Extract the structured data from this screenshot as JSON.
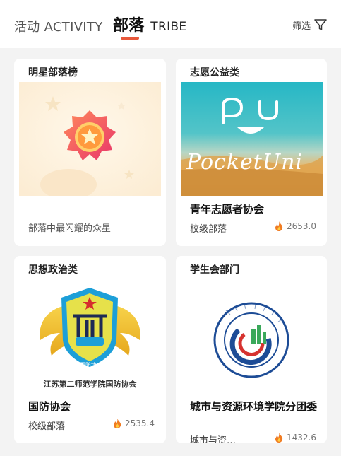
{
  "header": {
    "tab_activity": "活动 ACTIVITY",
    "tab_tribe_cn": "部落",
    "tab_tribe_en": "TRIBE",
    "filter_label": "筛选",
    "accent_color": "#e8583b"
  },
  "cards": [
    {
      "tag": "明星部落榜",
      "subtitle": "部落中最闪耀的众星",
      "icon": "star-badge"
    },
    {
      "tag": "志愿公益类",
      "image_text": "PocketUni",
      "title": "青年志愿者协会",
      "subtitle": "校级部落",
      "heat": "2653.0"
    },
    {
      "tag": "思想政治类",
      "image_text": "江苏第二师范学院国防协会",
      "logo_badge_text": "国防协会",
      "title": "国防协会",
      "subtitle": "校级部落",
      "heat": "2535.4"
    },
    {
      "tag": "学生会部门",
      "title": "城市与资源环境学院分团委",
      "subtitle": "城市与资…",
      "heat": "1432.6"
    }
  ]
}
